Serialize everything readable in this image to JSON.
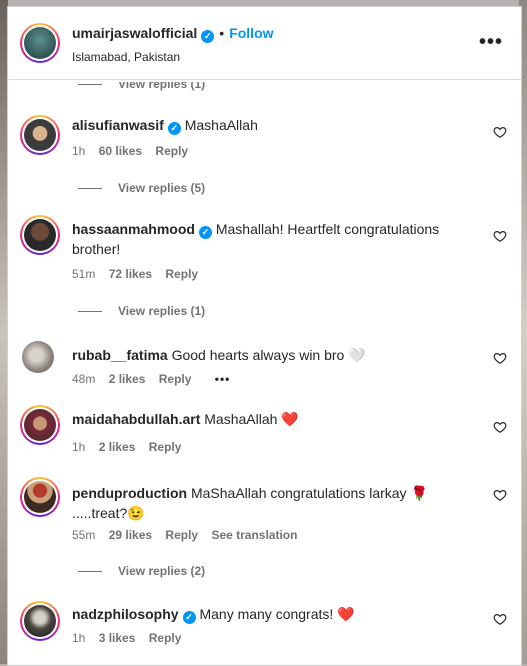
{
  "post_header": {
    "username": "umairjaswalofficial",
    "verified_mark": "✓",
    "separator": "•",
    "follow_label": "Follow",
    "location": "Islamabad, Pakistan",
    "more_label": "•••"
  },
  "top_partial_replies": "View replies (1)",
  "comments": [
    {
      "username": "alisufianwasif",
      "verified": true,
      "text": "MashaAllah",
      "time": "1h",
      "likes": "60 likes",
      "reply": "Reply",
      "replies_label": "View replies (5)"
    },
    {
      "username": "hassaanmahmood",
      "verified": true,
      "text": "Mashallah! Heartfelt congratulations brother!",
      "time": "51m",
      "likes": "72 likes",
      "reply": "Reply",
      "replies_label": "View replies (1)"
    },
    {
      "username": "rubab__fatima",
      "verified": false,
      "text": "Good hearts always win bro 🤍",
      "time": "48m",
      "likes": "2 likes",
      "reply": "Reply",
      "options": "•••"
    },
    {
      "username": "maidahabdullah.art",
      "verified": false,
      "text": "MashaAllah ❤️",
      "time": "1h",
      "likes": "2 likes",
      "reply": "Reply"
    },
    {
      "username": "penduproduction",
      "verified": false,
      "text": "MaShaAllah congratulations larkay 🌹 .....treat?😉",
      "time": "55m",
      "likes": "29 likes",
      "reply": "Reply",
      "translate": "See translation",
      "replies_label": "View replies (2)"
    },
    {
      "username": "nadzphilosophy",
      "verified": true,
      "text": "Many many congrats! ❤️",
      "time": "1h",
      "likes": "3 likes",
      "reply": "Reply"
    }
  ],
  "colors": {
    "link_blue": "#0095f6",
    "muted_text": "#737373",
    "primary_text": "#262626",
    "heart_red": "#ed1c24"
  }
}
